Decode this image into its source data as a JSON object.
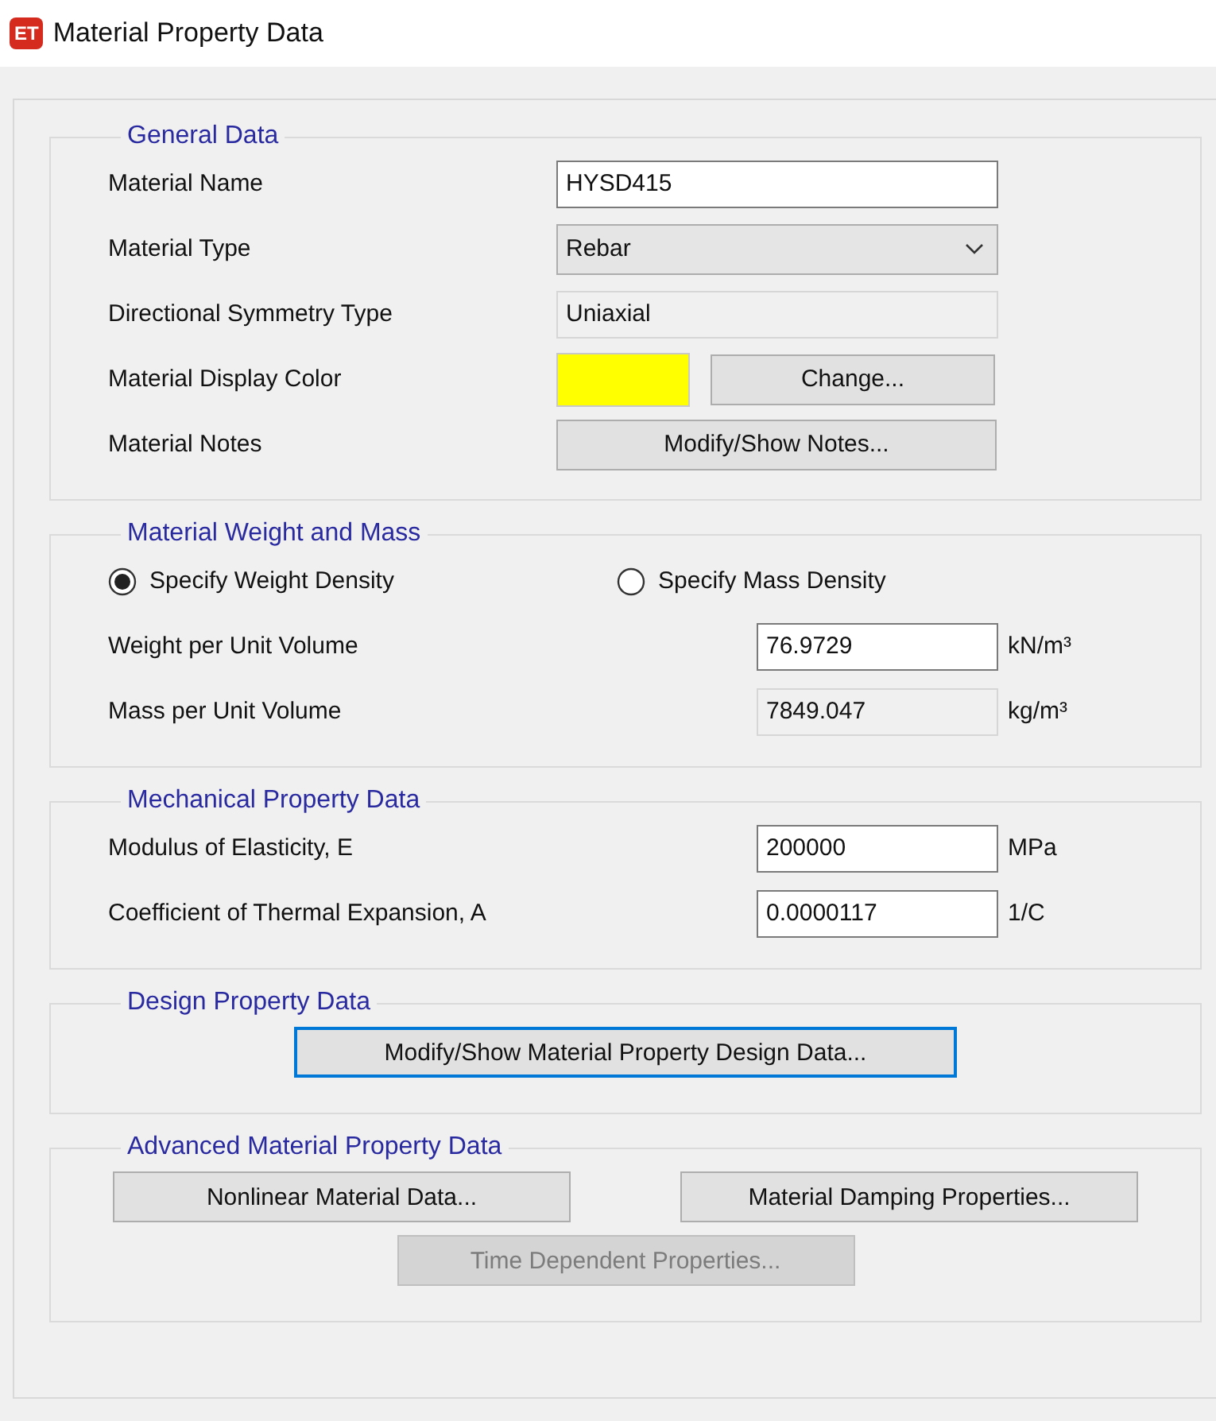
{
  "window": {
    "app_icon": "ET",
    "title": "Material Property Data"
  },
  "groups": [
    {
      "kind": "form",
      "title": "General Data",
      "rows": [
        {
          "kind": "text",
          "label": "Material Name",
          "value": "HYSD415",
          "readonly": false
        },
        {
          "kind": "dropdown",
          "label": "Material Type",
          "value": "Rebar"
        },
        {
          "kind": "text",
          "label": "Directional Symmetry Type",
          "value": "Uniaxial",
          "readonly": true
        },
        {
          "kind": "color",
          "label": "Material Display Color",
          "color": "#ffff00",
          "button": "Change..."
        },
        {
          "kind": "button",
          "label": "Material Notes",
          "button": "Modify/Show Notes..."
        }
      ]
    },
    {
      "kind": "form",
      "title": "Material Weight and Mass",
      "rows": [
        {
          "kind": "radios",
          "options": [
            {
              "label": "Specify Weight Density",
              "selected": true
            },
            {
              "label": "Specify Mass Density",
              "selected": false
            }
          ]
        },
        {
          "kind": "measure",
          "label": "Weight per Unit Volume",
          "value": "76.9729",
          "unit": "kN/m³",
          "readonly": false
        },
        {
          "kind": "measure",
          "label": "Mass per Unit Volume",
          "value": "7849.047",
          "unit": "kg/m³",
          "readonly": true
        }
      ]
    },
    {
      "kind": "form",
      "title": "Mechanical Property Data",
      "rows": [
        {
          "kind": "measure",
          "label": "Modulus of Elasticity,  E",
          "value": "200000",
          "unit": "MPa",
          "readonly": false
        },
        {
          "kind": "measure",
          "label": "Coefficient of Thermal Expansion,  A",
          "value": "0.0000117",
          "unit": "1/C",
          "readonly": false
        }
      ]
    },
    {
      "kind": "buttons",
      "title": "Design Property Data",
      "buttons": [
        {
          "label": "Modify/Show Material Property Design Data...",
          "focused": true,
          "disabled": false
        }
      ]
    },
    {
      "kind": "buttons",
      "title": "Advanced Material Property Data",
      "buttons": [
        {
          "label": "Nonlinear Material Data...",
          "focused": false,
          "disabled": false
        },
        {
          "label": "Material Damping Properties...",
          "focused": false,
          "disabled": false
        },
        {
          "label": "Time Dependent Properties...",
          "focused": false,
          "disabled": true
        }
      ]
    }
  ]
}
